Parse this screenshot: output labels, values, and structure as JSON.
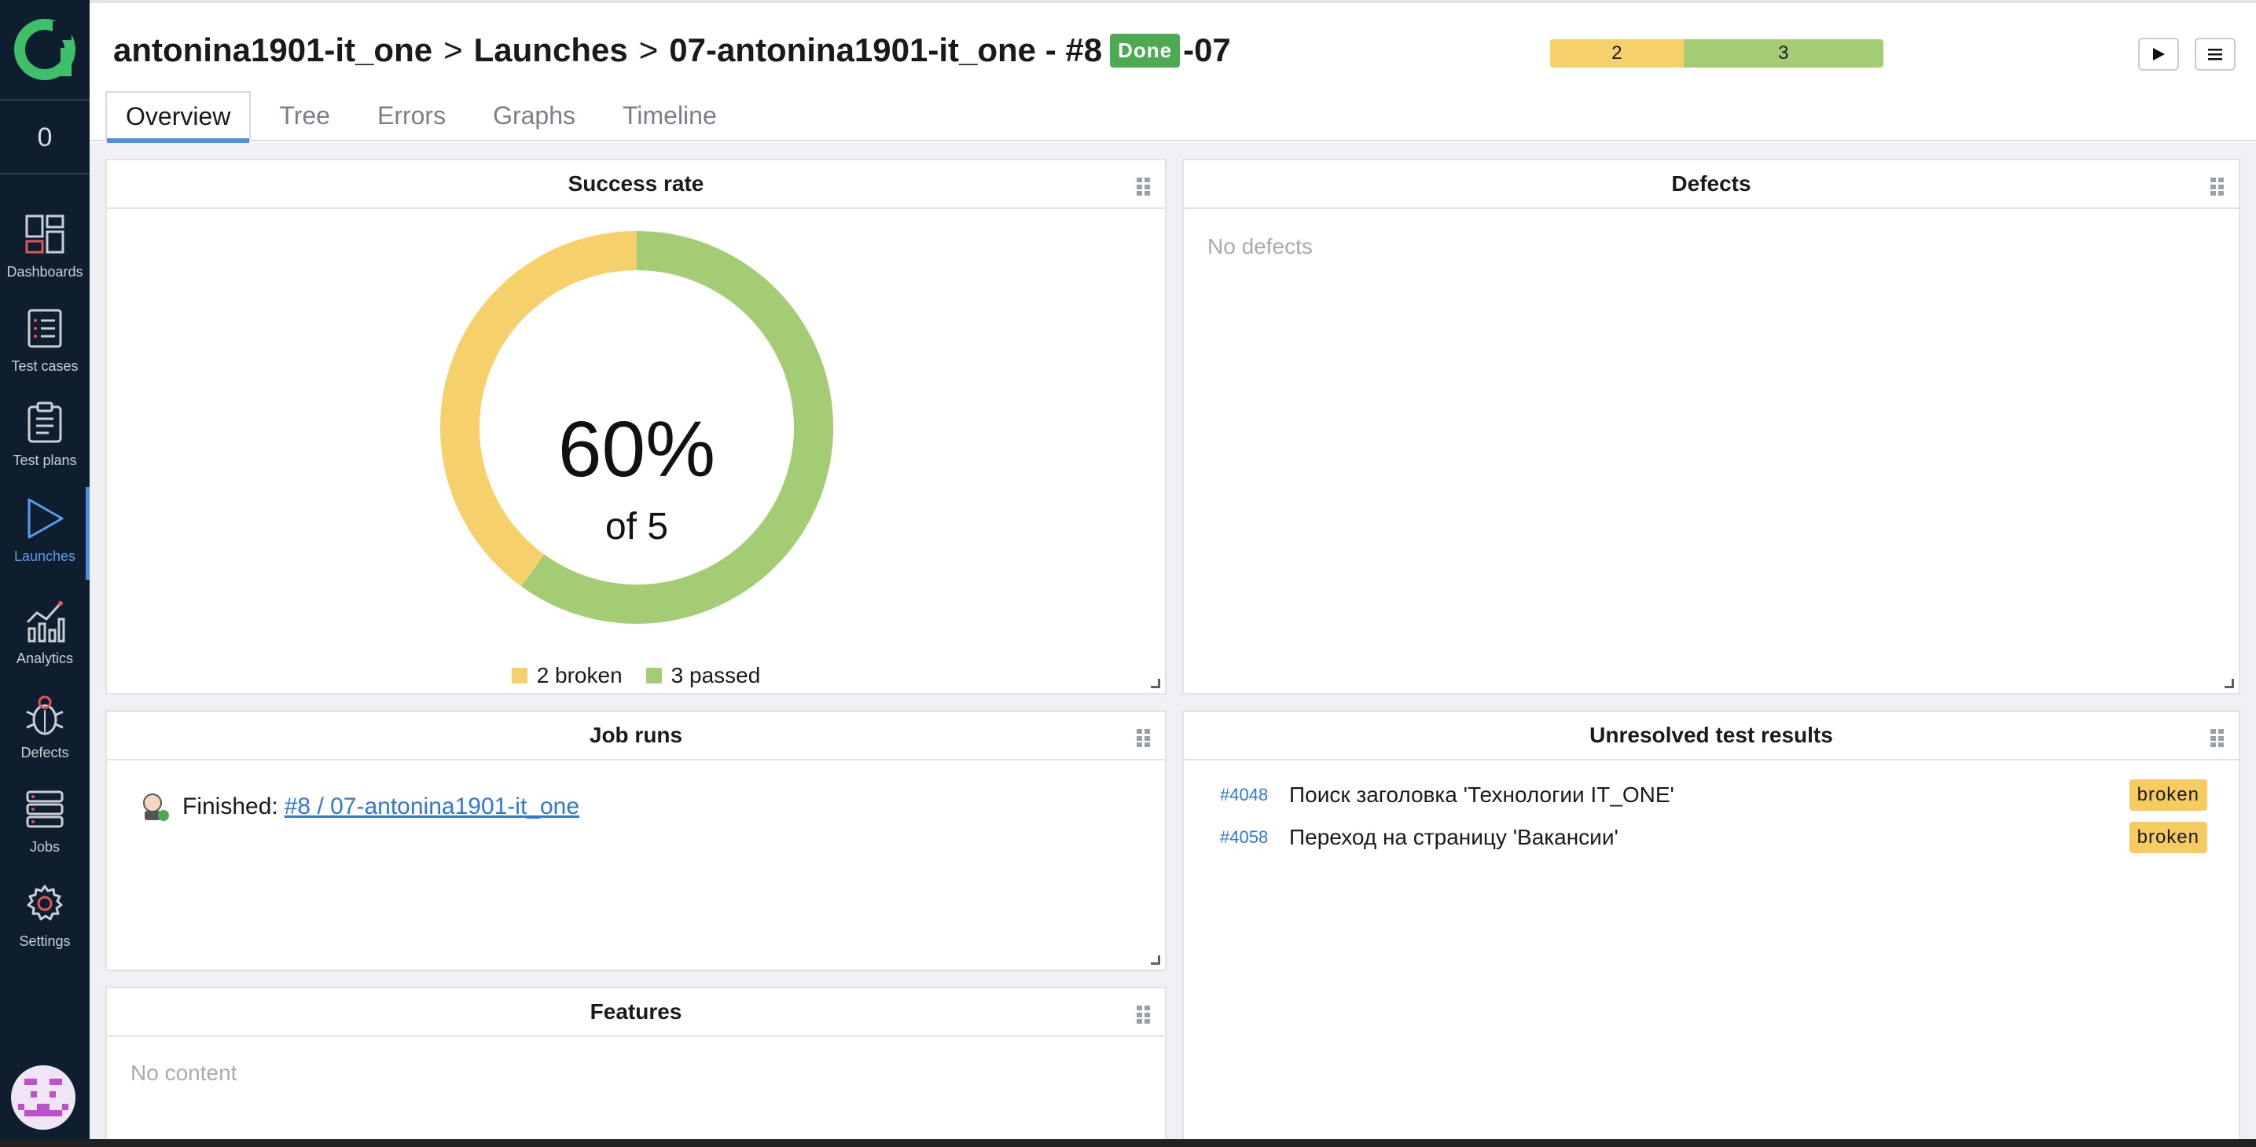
{
  "sidebar": {
    "counter": "0",
    "items": [
      {
        "label": "Dashboards",
        "icon": "dashboards-icon"
      },
      {
        "label": "Test cases",
        "icon": "test-cases-icon"
      },
      {
        "label": "Test plans",
        "icon": "test-plans-icon"
      },
      {
        "label": "Launches",
        "icon": "launches-icon",
        "active": true
      },
      {
        "label": "Analytics",
        "icon": "analytics-icon"
      },
      {
        "label": "Defects",
        "icon": "defects-icon"
      },
      {
        "label": "Jobs",
        "icon": "jobs-icon"
      },
      {
        "label": "Settings",
        "icon": "settings-icon"
      }
    ]
  },
  "header": {
    "project": "antonina1901-it_one",
    "section": "Launches",
    "launch_name": "07-antonina1901-it_one - #8",
    "status_badge": "Done",
    "suffix": "-07",
    "progress": {
      "broken": "2",
      "passed": "3",
      "broken_fraction": 0.4,
      "passed_fraction": 0.6
    }
  },
  "tabs": [
    "Overview",
    "Tree",
    "Errors",
    "Graphs",
    "Timeline"
  ],
  "widgets": {
    "success_rate": {
      "title": "Success rate",
      "percent": "60%",
      "of_total": "of 5",
      "legend_broken": "2 broken",
      "legend_passed": "3 passed"
    },
    "defects": {
      "title": "Defects",
      "empty": "No defects"
    },
    "job_runs": {
      "title": "Job runs",
      "status": "Finished:",
      "link": "#8 / 07-antonina1901-it_one"
    },
    "unresolved": {
      "title": "Unresolved test results",
      "rows": [
        {
          "id": "#4048",
          "name": "Поиск заголовка 'Технологии IT_ONE'",
          "status": "broken"
        },
        {
          "id": "#4058",
          "name": "Переход на страницу 'Вакансии'",
          "status": "broken"
        }
      ]
    },
    "features": {
      "title": "Features",
      "empty": "No content"
    }
  },
  "colors": {
    "broken": "#f6d16b",
    "passed": "#a4cc74",
    "accent": "#4a8fe8",
    "done": "#4eaa52",
    "sidebar": "#0f1e2e"
  },
  "chart_data": {
    "type": "pie",
    "title": "Success rate",
    "categories": [
      "broken",
      "passed"
    ],
    "values": [
      2,
      3
    ]
  }
}
